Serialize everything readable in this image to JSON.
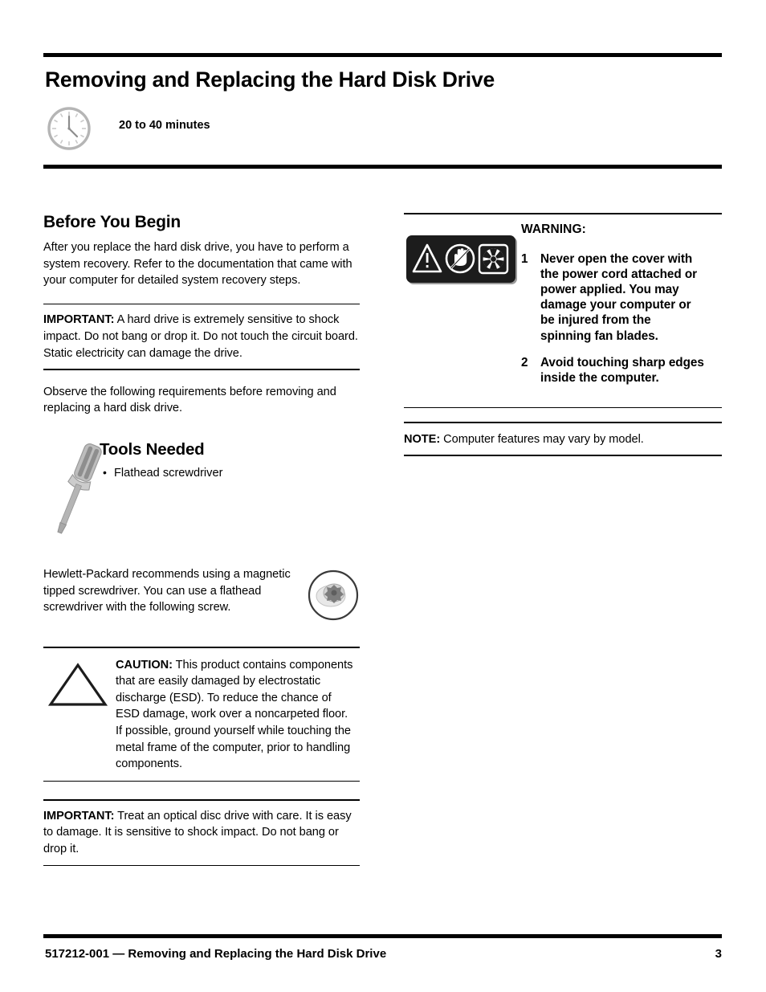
{
  "header": {
    "title": "Removing and Replacing the Hard Disk Drive",
    "duration": "20 to 40 minutes",
    "clock_icon": "clock-icon"
  },
  "left_column": {
    "before_you_begin": {
      "heading": "Before You Begin",
      "paragraph": "After you replace the hard disk drive, you have to perform a system recovery. Refer to the documentation that came with your computer for detailed system recovery steps."
    },
    "important_drive": {
      "label": "IMPORTANT:",
      "text": " A hard drive is extremely sensitive to shock impact. Do not bang or drop it. Do not touch the circuit board. Static electricity can damage the drive."
    },
    "observe_paragraph": "Observe the following requirements before removing and replacing a hard disk drive.",
    "tools": {
      "heading": "Tools Needed",
      "items": [
        "Flathead screwdriver"
      ],
      "icon": "screwdriver-icon"
    },
    "recommendation": {
      "text": "Hewlett-Packard recommends using a magnetic tipped screwdriver. You can use a flathead screwdriver with the following screw.",
      "icon": "screw-icon"
    },
    "caution": {
      "label": "CAUTION:",
      "text": " This product contains components that are easily damaged by electrostatic discharge (ESD). To reduce the chance of ESD damage, work over a noncarpeted floor. If possible, ground yourself while touching the metal frame of the computer, prior to handling components.",
      "icon": "caution-triangle-icon"
    },
    "important_optical": {
      "label": "IMPORTANT:",
      "text": " Treat an optical disc drive with care. It is easy to damage. It is sensitive to shock impact. Do not bang or drop it."
    }
  },
  "right_column": {
    "warning": {
      "heading": "WARNING:",
      "icons": [
        "warning-triangle-icon",
        "no-hand-icon",
        "fan-icon"
      ],
      "items": [
        {
          "num": "1",
          "text": "Never open the cover with the power cord attached or power applied. You may damage your computer or be injured from the spinning fan blades."
        },
        {
          "num": "2",
          "text": "Avoid touching sharp edges inside the computer."
        }
      ]
    },
    "note": {
      "label": "NOTE:",
      "text": " Computer features may vary by model."
    }
  },
  "footer": {
    "text": "517212-001 — Removing and Replacing the Hard Disk Drive",
    "page_number": "3"
  },
  "colors": {
    "ink": "#000000",
    "panel_black": "#1c1c1c",
    "icon_gray": "#b0b0b0",
    "metal_gray": "#9a9a9a"
  }
}
